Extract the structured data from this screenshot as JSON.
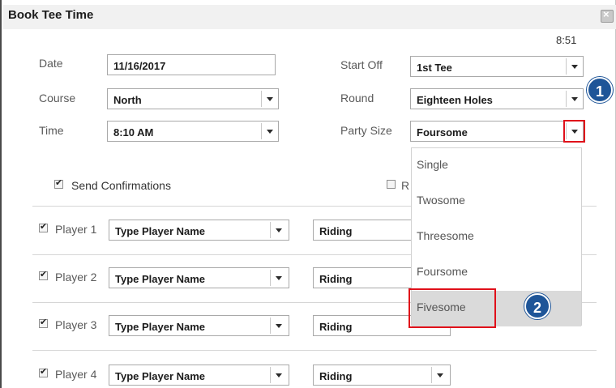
{
  "dialog": {
    "title": "Book Tee Time",
    "clock": "8:51"
  },
  "form": {
    "date_label": "Date",
    "date_value": "11/16/2017",
    "course_label": "Course",
    "course_value": "North",
    "time_label": "Time",
    "time_value": "8:10 AM",
    "start_off_label": "Start Off",
    "start_off_value": "1st Tee",
    "round_label": "Round",
    "round_value": "Eighteen Holes",
    "party_size_label": "Party Size",
    "party_size_value": "Foursome",
    "send_confirmations_label": "Send Confirmations",
    "right_check_label": "R"
  },
  "players": [
    {
      "label": "Player 1",
      "placeholder": "Type Player Name",
      "cart": "Riding"
    },
    {
      "label": "Player 2",
      "placeholder": "Type Player Name",
      "cart": "Riding"
    },
    {
      "label": "Player 3",
      "placeholder": "Type Player Name",
      "cart": "Riding"
    },
    {
      "label": "Player 4",
      "placeholder": "Type Player Name",
      "cart": "Riding"
    }
  ],
  "party_size_options": [
    "Single",
    "Twosome",
    "Threesome",
    "Foursome",
    "Fivesome"
  ],
  "callouts": {
    "one": "1",
    "two": "2"
  },
  "colors": {
    "highlight": "#e0101a",
    "badge": "#1e5598"
  }
}
